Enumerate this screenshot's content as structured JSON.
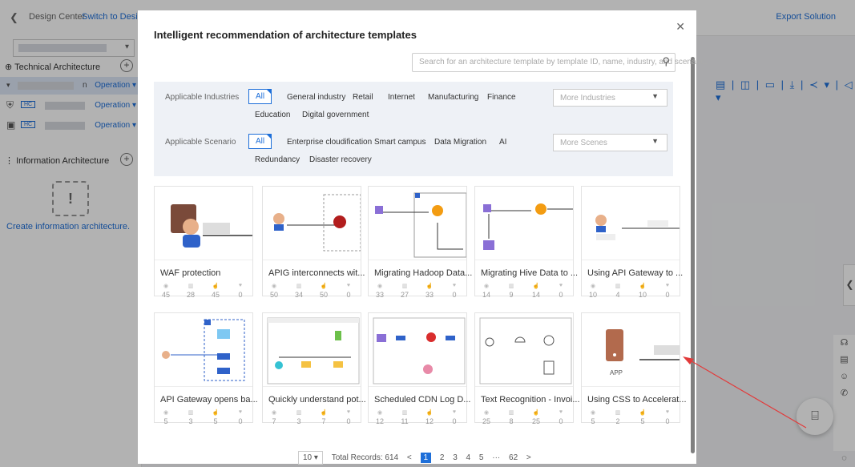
{
  "header": {
    "back_icon": "chevron-left-icon",
    "breadcrumb": "Design Center",
    "switch_link": "Switch to Design C",
    "export_label": "Export Solution"
  },
  "sidebar": {
    "technical_title": "Technical Architecture",
    "info_title": "Information Architecture",
    "rows": [
      {
        "suffix": "n",
        "op": "Operation ▾"
      },
      {
        "tag": "HC",
        "op": "Operation ▾"
      },
      {
        "tag": "HC",
        "op": "Operation ▾"
      }
    ],
    "create_info_label": "Create information architecture."
  },
  "modal": {
    "title": "Intelligent recommendation of architecture templates",
    "search_placeholder": "Search for an architecture template by template ID, name, industry, and scenario.",
    "industries_label": "Applicable Industries",
    "industries": [
      "All",
      "General industry",
      "Retail",
      "Internet",
      "Manufacturing",
      "Finance",
      "Education",
      "Digital government"
    ],
    "industries_more": "More Industries",
    "scenario_label": "Applicable Scenario",
    "scenarios": [
      "All",
      "Enterprise cloudification",
      "Smart campus",
      "Data Migration",
      "AI",
      "Redundancy",
      "Disaster recovery"
    ],
    "scenario_more": "More Scenes"
  },
  "cards": [
    {
      "title": "WAF protection",
      "stats": [
        "45",
        "28",
        "45",
        "0"
      ]
    },
    {
      "title": "APIG interconnects wit...",
      "stats": [
        "50",
        "34",
        "50",
        "0"
      ]
    },
    {
      "title": "Migrating Hadoop Data...",
      "stats": [
        "33",
        "27",
        "33",
        "0"
      ]
    },
    {
      "title": "Migrating Hive Data to ...",
      "stats": [
        "14",
        "9",
        "14",
        "0"
      ]
    },
    {
      "title": "Using API Gateway to ...",
      "stats": [
        "10",
        "4",
        "10",
        "0"
      ]
    },
    {
      "title": "API Gateway opens ba...",
      "stats": [
        "5",
        "3",
        "5",
        "0"
      ]
    },
    {
      "title": "Quickly understand pot...",
      "stats": [
        "7",
        "3",
        "7",
        "0"
      ]
    },
    {
      "title": "Scheduled CDN Log D...",
      "stats": [
        "12",
        "11",
        "12",
        "0"
      ]
    },
    {
      "title": "Text Recognition - Invoi...",
      "stats": [
        "25",
        "8",
        "25",
        "0"
      ]
    },
    {
      "title": "Using CSS to Accelerat...",
      "stats": [
        "5",
        "2",
        "5",
        "0"
      ]
    }
  ],
  "card_thumb_text": {
    "app": "APP"
  },
  "pager": {
    "page_size": "10",
    "total": "Total Records: 614",
    "pages": [
      "1",
      "2",
      "3",
      "4",
      "5",
      "···",
      "62"
    ],
    "prev": "<",
    "next": ">"
  },
  "colors": {
    "accent": "#1e6fd9",
    "annotation_arrow": "#e23b3b"
  }
}
